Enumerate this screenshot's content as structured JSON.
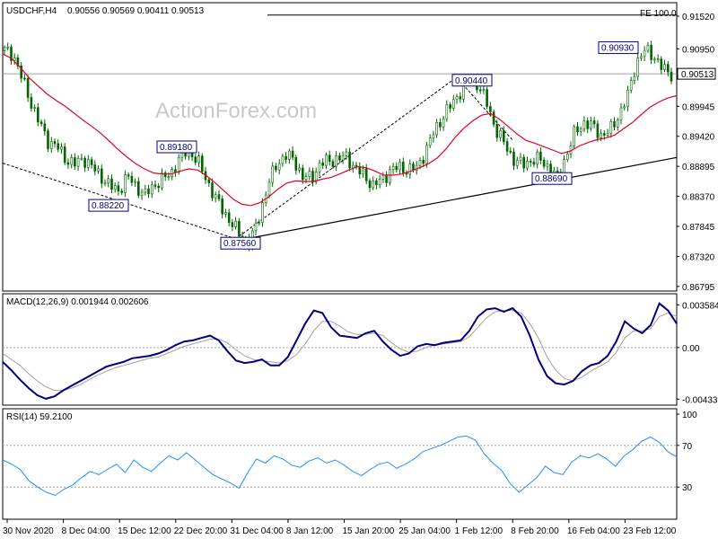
{
  "watermark": "ActionForex.com",
  "colors": {
    "background": "#ffffff",
    "frame": "#000000",
    "bull_candle": "#006400",
    "bear_candle": "#006400",
    "sma": "#e0002a",
    "trend": "#000000",
    "label_border": "#000080",
    "label_text": "#000080",
    "macd_line": "#000080",
    "signal_line": "#a0a0a0",
    "rsi_line": "#1e90ff",
    "level_line": "#a0a0a0",
    "watermark": "#c8c8c8"
  },
  "chart_data": [
    {
      "type": "candlestick",
      "title": "USDCHF,H4",
      "ohlc_header": "0.90556 0.90569 0.90411 0.90513",
      "ylim": [
        0.8673,
        0.9174
      ],
      "y_ticks": [
        "0.91520",
        "0.90950",
        "0.90513",
        "0.89945",
        "0.89420",
        "0.88895",
        "0.88370",
        "0.87845",
        "0.87320",
        "0.86795"
      ],
      "current_price": "0.90513",
      "fe_label": "FE 100.0",
      "fe_level": 0.9154,
      "x_ticks": [
        "30 Nov 2020",
        "8 Dec 04:00",
        "15 Dec 12:00",
        "22 Dec 20:00",
        "31 Dec 04:00",
        "8 Jan 12:00",
        "15 Jan 20:00",
        "25 Jan 04:00",
        "1 Feb 12:00",
        "8 Feb 20:00",
        "16 Feb 04:00",
        "23 Feb 12:00"
      ],
      "price_path": [
        0.9092,
        0.9085,
        0.9043,
        0.9002,
        0.8964,
        0.8933,
        0.8924,
        0.8902,
        0.8893,
        0.8904,
        0.8888,
        0.8872,
        0.8855,
        0.8847,
        0.8872,
        0.8855,
        0.8839,
        0.8856,
        0.8867,
        0.8877,
        0.8906,
        0.8918,
        0.8899,
        0.8867,
        0.8835,
        0.881,
        0.8787,
        0.8766,
        0.8756,
        0.88,
        0.8856,
        0.8893,
        0.8909,
        0.8901,
        0.887,
        0.8869,
        0.8895,
        0.8899,
        0.8903,
        0.8906,
        0.8886,
        0.8873,
        0.8856,
        0.8865,
        0.8883,
        0.8888,
        0.8883,
        0.8887,
        0.8916,
        0.8952,
        0.8977,
        0.8999,
        0.9021,
        0.9044,
        0.9032,
        0.8999,
        0.8954,
        0.8928,
        0.8902,
        0.8892,
        0.89,
        0.8902,
        0.8888,
        0.8869,
        0.8908,
        0.8948,
        0.8966,
        0.896,
        0.8944,
        0.8951,
        0.8979,
        0.9011,
        0.9071,
        0.9093,
        0.9083,
        0.906,
        0.9051
      ],
      "sma_path": [
        0.9086,
        0.9078,
        0.9062,
        0.9044,
        0.903,
        0.9016,
        0.9005,
        0.8995,
        0.8983,
        0.8971,
        0.896,
        0.8948,
        0.8934,
        0.8919,
        0.8906,
        0.8894,
        0.8885,
        0.8878,
        0.8876,
        0.8876,
        0.8881,
        0.8885,
        0.8883,
        0.8873,
        0.886,
        0.8846,
        0.8832,
        0.8823,
        0.8821,
        0.8826,
        0.8836,
        0.8849,
        0.886,
        0.8864,
        0.8863,
        0.8863,
        0.8867,
        0.887,
        0.8876,
        0.8883,
        0.8889,
        0.8887,
        0.8881,
        0.8874,
        0.8874,
        0.8876,
        0.8881,
        0.8887,
        0.8894,
        0.8904,
        0.892,
        0.894,
        0.8956,
        0.8969,
        0.8979,
        0.8982,
        0.8972,
        0.8959,
        0.8946,
        0.8935,
        0.893,
        0.8924,
        0.8918,
        0.8912,
        0.8916,
        0.8925,
        0.8931,
        0.8936,
        0.8939,
        0.8944,
        0.8955,
        0.8966,
        0.898,
        0.8993,
        0.9002,
        0.9009,
        0.9013
      ],
      "trendlines": [
        {
          "from": [
            "30 Nov 2020",
            0.8895
          ],
          "to": [
            "31 Dec 04:00",
            0.8765
          ]
        },
        {
          "from": [
            "31 Dec 04:00",
            0.8758
          ],
          "to": [
            "23 Feb 12:00",
            0.8905
          ]
        },
        {
          "from": [
            "31 Dec 04:00",
            0.8758
          ],
          "to": [
            "1 Feb 12:00",
            0.9045
          ]
        },
        {
          "from": [
            "1 Feb 12:00",
            0.9045
          ],
          "to": [
            "8 Feb 20:00",
            0.8935
          ]
        }
      ],
      "annotations": [
        {
          "text": "0.88220",
          "value": 0.8822
        },
        {
          "text": "0.89180",
          "value": 0.8918
        },
        {
          "text": "0.87560",
          "value": 0.8756
        },
        {
          "text": "0.90440",
          "value": 0.9044
        },
        {
          "text": "0.88690",
          "value": 0.8869
        },
        {
          "text": "0.90930",
          "value": 0.9093
        }
      ]
    },
    {
      "type": "line",
      "title": "MACD(12,26,9) 0.001944 0.002606",
      "ylim": [
        -0.00476,
        0.00406
      ],
      "y_ticks": [
        "0.003584",
        "0.00",
        "-0.004331"
      ],
      "series": [
        {
          "values": [
            -0.0012,
            -0.0019,
            -0.0027,
            -0.0034,
            -0.004,
            -0.0043,
            -0.0041,
            -0.0036,
            -0.0032,
            -0.0028,
            -0.0024,
            -0.002,
            -0.0016,
            -0.0014,
            -0.0012,
            -0.0009,
            -0.0008,
            -0.0007,
            -0.0005,
            -0.0002,
            0.0002,
            0.0005,
            0.0006,
            0.0008,
            0.001,
            0.0006,
            -0.0003,
            -0.0011,
            -0.0013,
            -0.0012,
            -0.001,
            -0.0015,
            -0.0015,
            -0.0008,
            0.0006,
            0.002,
            0.0031,
            0.0029,
            0.0017,
            0.001,
            0.0009,
            0.0008,
            0.0012,
            0.0014,
            0.0005,
            -0.0002,
            -0.0007,
            -0.0005,
            0.0001,
            0.0003,
            0.0002,
            0.0004,
            0.0005,
            0.0006,
            0.0014,
            0.0026,
            0.0032,
            0.0033,
            0.003,
            0.0033,
            0.0026,
            0.001,
            -0.001,
            -0.0024,
            -0.003,
            -0.0031,
            -0.0028,
            -0.002,
            -0.0015,
            -0.0013,
            -0.0007,
            0.0005,
            0.0022,
            0.0016,
            0.0012,
            0.0019,
            0.0037,
            0.0031,
            0.002
          ]
        },
        {
          "values": [
            -0.0005,
            -0.001,
            -0.0015,
            -0.0022,
            -0.0028,
            -0.0033,
            -0.0036,
            -0.0036,
            -0.0034,
            -0.0031,
            -0.0027,
            -0.0023,
            -0.002,
            -0.0017,
            -0.0015,
            -0.0013,
            -0.0011,
            -0.0009,
            -0.0008,
            -0.0005,
            -0.0002,
            0.0001,
            0.0003,
            0.0005,
            0.0007,
            0.0007,
            0.0004,
            -0.0002,
            -0.0007,
            -0.001,
            -0.0011,
            -0.0012,
            -0.0013,
            -0.0011,
            -0.0006,
            0.0003,
            0.0014,
            0.0022,
            0.0022,
            0.0018,
            0.0013,
            0.0011,
            0.0011,
            0.0012,
            0.001,
            0.0004,
            -0.0001,
            -0.0004,
            -0.0003,
            0.0,
            0.0002,
            0.0003,
            0.0004,
            0.0005,
            0.0009,
            0.0017,
            0.0025,
            0.003,
            0.0031,
            0.0031,
            0.0029,
            0.002,
            0.0008,
            -0.0008,
            -0.0019,
            -0.0026,
            -0.0028,
            -0.0025,
            -0.002,
            -0.0016,
            -0.0012,
            -0.0004,
            0.0008,
            0.0014,
            0.0014,
            0.0016,
            0.0026,
            0.0029,
            0.0026
          ]
        }
      ]
    },
    {
      "type": "line",
      "title": "RSI(14) 59.2100",
      "ylim": [
        0,
        100
      ],
      "y_ticks": [
        "100",
        "70",
        "30",
        "0"
      ],
      "levels": [
        70,
        30
      ],
      "series": [
        {
          "values": [
            56,
            52,
            47,
            36,
            30,
            25,
            22,
            28,
            32,
            39,
            45,
            42,
            47,
            52,
            44,
            56,
            49,
            45,
            53,
            60,
            56,
            63,
            56,
            49,
            42,
            38,
            34,
            29,
            44,
            57,
            53,
            60,
            57,
            51,
            49,
            55,
            58,
            53,
            56,
            51,
            45,
            41,
            47,
            52,
            54,
            48,
            52,
            57,
            64,
            67,
            70,
            74,
            78,
            79,
            75,
            62,
            53,
            46,
            33,
            25,
            32,
            39,
            50,
            44,
            42,
            54,
            60,
            58,
            62,
            57,
            50,
            60,
            66,
            74,
            78,
            73,
            64,
            59
          ]
        }
      ]
    }
  ]
}
